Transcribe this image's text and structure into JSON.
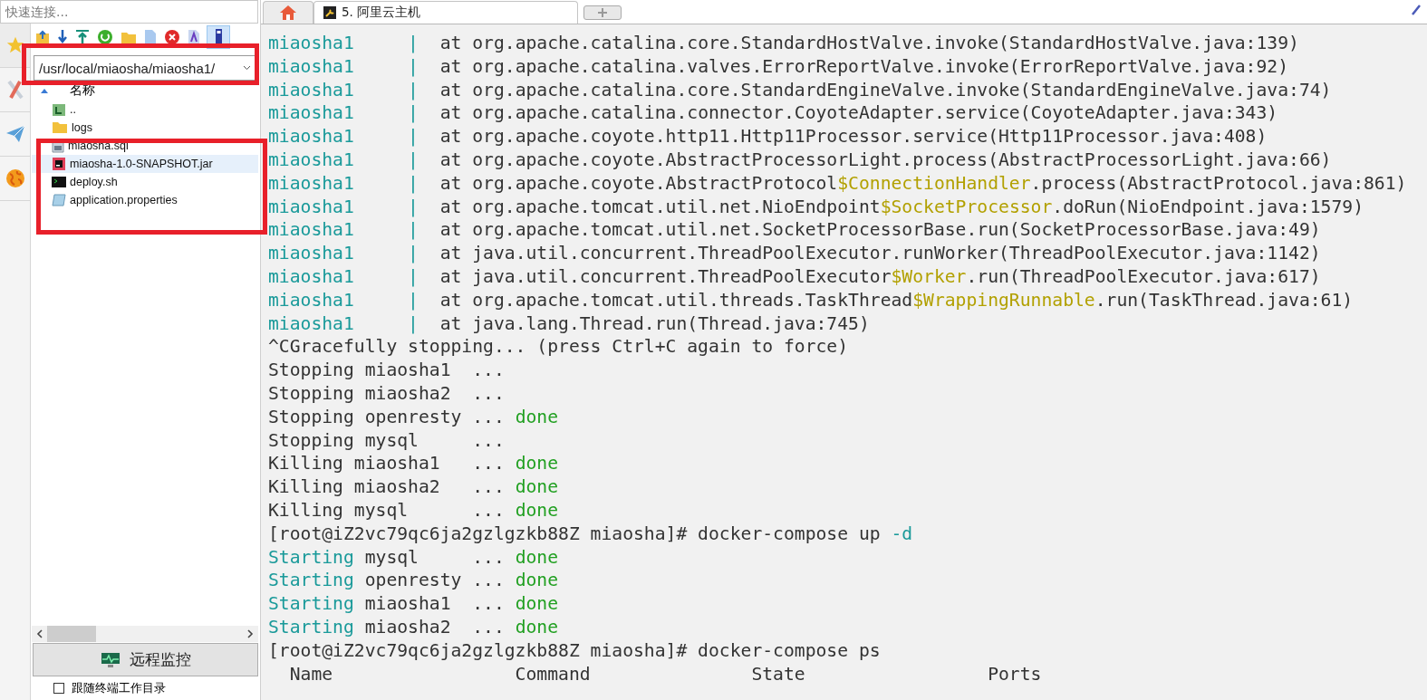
{
  "quick_connect": {
    "placeholder": "快速连接..."
  },
  "file_panel": {
    "path": "/usr/local/miaosha/miaosha1/",
    "header": "名称",
    "files": [
      {
        "name": "..",
        "kind": "up",
        "selected": false
      },
      {
        "name": "logs",
        "kind": "folder",
        "selected": false
      },
      {
        "name": "miaosha.sql",
        "kind": "sql",
        "selected": false
      },
      {
        "name": "miaosha-1.0-SNAPSHOT.jar",
        "kind": "jar",
        "selected": true
      },
      {
        "name": "deploy.sh",
        "kind": "sh",
        "selected": false
      },
      {
        "name": "application.properties",
        "kind": "props",
        "selected": false
      }
    ]
  },
  "remote_monitor_button": "远程监控",
  "follow_checkbox": {
    "label": "跟随终端工作目录",
    "checked": false
  },
  "tabs": [
    {
      "kind": "home",
      "selected": false
    },
    {
      "kind": "session",
      "label": "5. 阿里云主机",
      "selected": true
    }
  ],
  "terminal": {
    "lines": [
      [
        {
          "text": "miaosha1     |",
          "kind": "service"
        },
        {
          "text": "  at org.apache.catalina.core.StandardHostValve.invoke(StandardHostValve.java:139)",
          "kind": "plain"
        }
      ],
      [
        {
          "text": "miaosha1     |",
          "kind": "service"
        },
        {
          "text": "  at org.apache.catalina.valves.ErrorReportValve.invoke(ErrorReportValve.java:92)",
          "kind": "plain"
        }
      ],
      [
        {
          "text": "miaosha1     |",
          "kind": "service"
        },
        {
          "text": "  at org.apache.catalina.core.StandardEngineValve.invoke(StandardEngineValve.java:74)",
          "kind": "plain"
        }
      ],
      [
        {
          "text": "miaosha1     |",
          "kind": "service"
        },
        {
          "text": "  at org.apache.catalina.connector.CoyoteAdapter.service(CoyoteAdapter.java:343)",
          "kind": "plain"
        }
      ],
      [
        {
          "text": "miaosha1     |",
          "kind": "service"
        },
        {
          "text": "  at org.apache.coyote.http11.Http11Processor.service(Http11Processor.java:408)",
          "kind": "plain"
        }
      ],
      [
        {
          "text": "miaosha1     |",
          "kind": "service"
        },
        {
          "text": "  at org.apache.coyote.AbstractProcessorLight.process(AbstractProcessorLight.java:66)",
          "kind": "plain"
        }
      ],
      [
        {
          "text": "miaosha1     |",
          "kind": "service"
        },
        {
          "text": "  at org.apache.coyote.AbstractProtocol",
          "kind": "plain"
        },
        {
          "text": "$ConnectionHandler",
          "kind": "inner"
        },
        {
          "text": ".process(AbstractProtocol.java:861)",
          "kind": "plain"
        }
      ],
      [
        {
          "text": "miaosha1     |",
          "kind": "service"
        },
        {
          "text": "  at org.apache.tomcat.util.net.NioEndpoint",
          "kind": "plain"
        },
        {
          "text": "$SocketProcessor",
          "kind": "inner"
        },
        {
          "text": ".doRun(NioEndpoint.java:1579)",
          "kind": "plain"
        }
      ],
      [
        {
          "text": "miaosha1     |",
          "kind": "service"
        },
        {
          "text": "  at org.apache.tomcat.util.net.SocketProcessorBase.run(SocketProcessorBase.java:49)",
          "kind": "plain"
        }
      ],
      [
        {
          "text": "miaosha1     |",
          "kind": "service"
        },
        {
          "text": "  at java.util.concurrent.ThreadPoolExecutor.runWorker(ThreadPoolExecutor.java:1142)",
          "kind": "plain"
        }
      ],
      [
        {
          "text": "miaosha1     |",
          "kind": "service"
        },
        {
          "text": "  at java.util.concurrent.ThreadPoolExecutor",
          "kind": "plain"
        },
        {
          "text": "$Worker",
          "kind": "inner"
        },
        {
          "text": ".run(ThreadPoolExecutor.java:617)",
          "kind": "plain"
        }
      ],
      [
        {
          "text": "miaosha1     |",
          "kind": "service"
        },
        {
          "text": "  at org.apache.tomcat.util.threads.TaskThread",
          "kind": "plain"
        },
        {
          "text": "$WrappingRunnable",
          "kind": "inner"
        },
        {
          "text": ".run(TaskThread.java:61)",
          "kind": "plain"
        }
      ],
      [
        {
          "text": "miaosha1     |",
          "kind": "service"
        },
        {
          "text": "  at java.lang.Thread.run(Thread.java:745)",
          "kind": "plain"
        }
      ],
      [
        {
          "text": "^CGracefully stopping... (press Ctrl+C again to force)",
          "kind": "plain"
        }
      ],
      [
        {
          "text": "Stopping miaosha1  ...",
          "kind": "plain"
        }
      ],
      [
        {
          "text": "Stopping miaosha2  ...",
          "kind": "plain"
        }
      ],
      [
        {
          "text": "Stopping openresty ... ",
          "kind": "plain"
        },
        {
          "text": "done",
          "kind": "done"
        }
      ],
      [
        {
          "text": "Stopping mysql     ...",
          "kind": "plain"
        }
      ],
      [
        {
          "text": "Killing miaosha1   ... ",
          "kind": "plain"
        },
        {
          "text": "done",
          "kind": "done"
        }
      ],
      [
        {
          "text": "Killing miaosha2   ... ",
          "kind": "plain"
        },
        {
          "text": "done",
          "kind": "done"
        }
      ],
      [
        {
          "text": "Killing mysql      ... ",
          "kind": "plain"
        },
        {
          "text": "done",
          "kind": "done"
        }
      ],
      [
        {
          "text": "[root@iZ2vc79qc6ja2gzlgzkb88Z miaosha]# docker-compose up ",
          "kind": "plain"
        },
        {
          "text": "-d",
          "kind": "service"
        }
      ],
      [
        {
          "text": "Starting",
          "kind": "service"
        },
        {
          "text": " mysql     ... ",
          "kind": "plain"
        },
        {
          "text": "done",
          "kind": "done"
        }
      ],
      [
        {
          "text": "Starting",
          "kind": "service"
        },
        {
          "text": " openresty ... ",
          "kind": "plain"
        },
        {
          "text": "done",
          "kind": "done"
        }
      ],
      [
        {
          "text": "Starting",
          "kind": "service"
        },
        {
          "text": " miaosha1  ... ",
          "kind": "plain"
        },
        {
          "text": "done",
          "kind": "done"
        }
      ],
      [
        {
          "text": "Starting",
          "kind": "service"
        },
        {
          "text": " miaosha2  ... ",
          "kind": "plain"
        },
        {
          "text": "done",
          "kind": "done"
        }
      ],
      [
        {
          "text": "[root@iZ2vc79qc6ja2gzlgzkb88Z miaosha]# docker-compose ps",
          "kind": "plain"
        }
      ],
      [
        {
          "text": "  Name                 Command               State                 Ports",
          "kind": "plain"
        }
      ]
    ]
  }
}
